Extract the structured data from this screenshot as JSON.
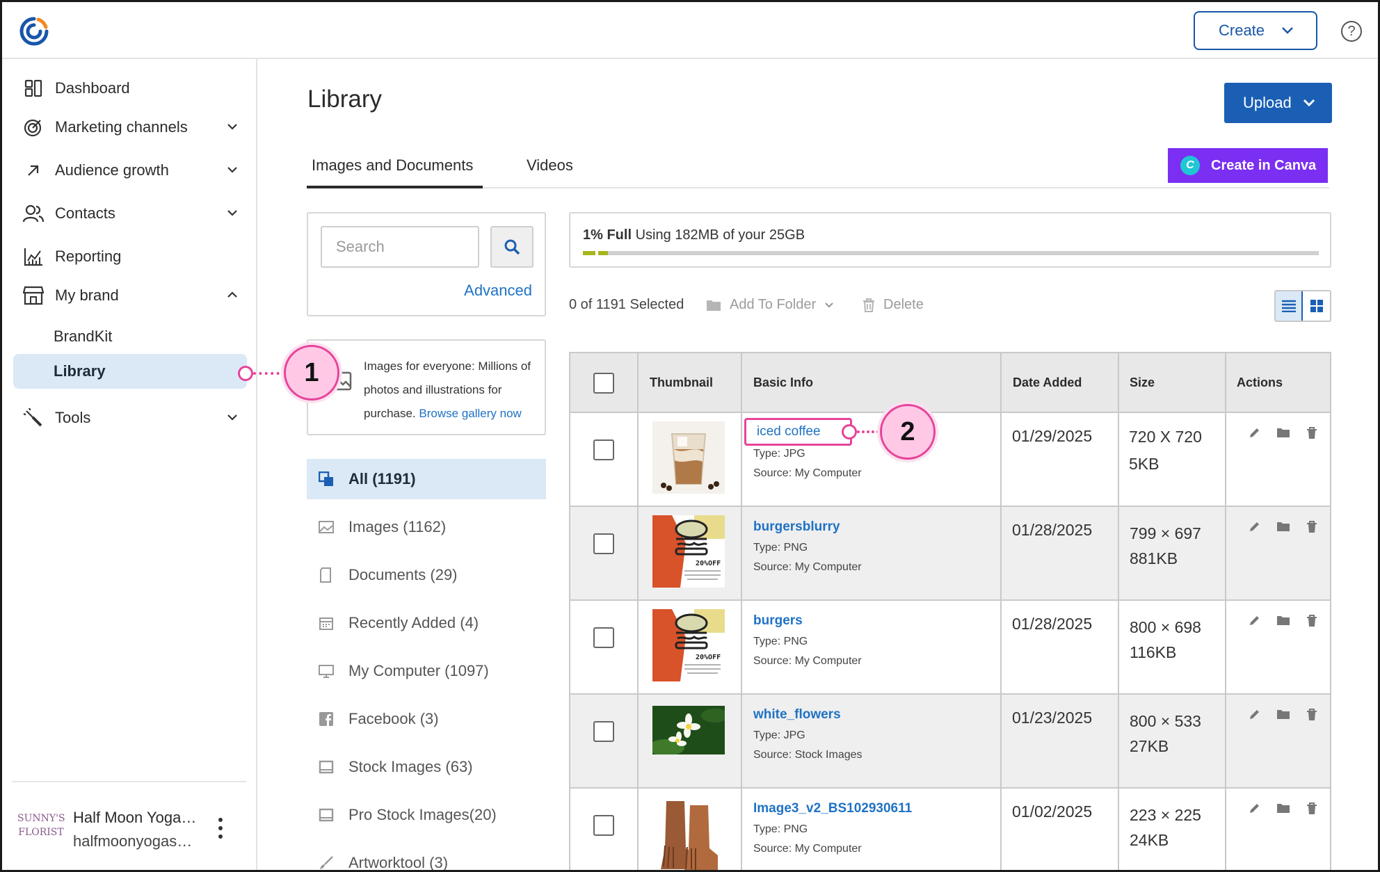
{
  "header": {
    "create_label": "Create",
    "help_label": "?"
  },
  "sidebar": {
    "items": [
      {
        "label": "Dashboard",
        "icon": "dashboard-icon"
      },
      {
        "label": "Marketing channels",
        "icon": "target-icon"
      },
      {
        "label": "Audience growth",
        "icon": "arrow-up-right-icon"
      },
      {
        "label": "Contacts",
        "icon": "people-icon"
      },
      {
        "label": "Reporting",
        "icon": "chart-icon"
      },
      {
        "label": "My brand",
        "icon": "store-icon"
      }
    ],
    "sub_items": [
      {
        "label": "BrandKit"
      },
      {
        "label": "Library"
      }
    ],
    "tools_label": "Tools",
    "account": {
      "logo_text_line1": "SUNNY'S",
      "logo_text_line2": "FLORIST",
      "name": "Half Moon Yoga…",
      "email": "halfmoonyogas…"
    }
  },
  "main": {
    "title": "Library",
    "upload_label": "Upload",
    "tabs": [
      {
        "label": "Images and Documents"
      },
      {
        "label": "Videos"
      }
    ],
    "canva_label": "Create in Canva",
    "canva_icon_text": "C",
    "search": {
      "placeholder": "Search",
      "advanced_label": "Advanced"
    },
    "promo": {
      "text": "Images for everyone: Millions of photos and illustrations for purchase.",
      "link": "Browse gallery now"
    },
    "filters": [
      {
        "label": "All (1191)"
      },
      {
        "label": "Images (1162)"
      },
      {
        "label": "Documents (29)"
      },
      {
        "label": "Recently Added (4)"
      },
      {
        "label": "My Computer (1097)"
      },
      {
        "label": "Facebook (3)"
      },
      {
        "label": "Stock Images (63)"
      },
      {
        "label": "Pro Stock Images(20)"
      },
      {
        "label": "Artworktool (3)"
      }
    ],
    "storage": {
      "percent_label": "1% Full",
      "usage_text": "Using 182MB of your 25GB",
      "fill_fraction": 0.01
    },
    "toolbar": {
      "selected_label": "0 of 1191 Selected",
      "add_to_folder_label": "Add To Folder",
      "delete_label": "Delete"
    },
    "table": {
      "headers": [
        "Thumbnail",
        "Basic Info",
        "Date Added",
        "Size",
        "Actions"
      ],
      "rows": [
        {
          "name": "iced coffee",
          "type": "Type: JPG",
          "source": "Source: My Computer",
          "date": "01/29/2025",
          "dims": "720 X 720",
          "size": "5KB",
          "thumb": "coffee"
        },
        {
          "name": "burgersblurry",
          "type": "Type: PNG",
          "source": "Source: My Computer",
          "date": "01/28/2025",
          "dims": "799 × 697",
          "size": "881KB",
          "thumb": "burger"
        },
        {
          "name": "burgers",
          "type": "Type: PNG",
          "source": "Source: My Computer",
          "date": "01/28/2025",
          "dims": "800 × 698",
          "size": "116KB",
          "thumb": "burger"
        },
        {
          "name": "white_flowers",
          "type": "Type: JPG",
          "source": "Source: Stock Images",
          "date": "01/23/2025",
          "dims": "800 × 533",
          "size": "27KB",
          "thumb": "flowers"
        },
        {
          "name": "Image3_v2_BS102930611",
          "type": "Type: PNG",
          "source": "Source: My Computer",
          "date": "01/02/2025",
          "dims": "223 × 225",
          "size": "24KB",
          "thumb": "boots"
        }
      ],
      "thumb_badge": "20%OFF"
    }
  },
  "callouts": [
    {
      "number": "1"
    },
    {
      "number": "2"
    }
  ],
  "colors": {
    "brand_blue": "#1a5fb4",
    "link_blue": "#1f72c4",
    "canva_purple": "#7b2ff2",
    "callout_pink": "#e6449a",
    "storage_green": "#a7b51d",
    "active_bg": "#dbe9f6"
  }
}
